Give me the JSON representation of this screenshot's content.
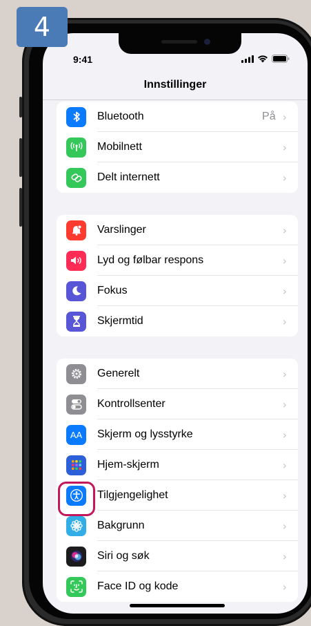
{
  "step": {
    "number": "4"
  },
  "status_bar": {
    "time": "9:41"
  },
  "nav": {
    "title": "Innstillinger"
  },
  "colors": {
    "highlight": "#c2185b",
    "step_badge": "#4a7bb7"
  },
  "groups": [
    {
      "items": [
        {
          "label": "Bluetooth",
          "value": "På",
          "icon": "bluetooth-icon",
          "color": "#0a7aff"
        },
        {
          "label": "Mobilnett",
          "value": "",
          "icon": "antenna-icon",
          "color": "#34c759"
        },
        {
          "label": "Delt internett",
          "value": "",
          "icon": "link-icon",
          "color": "#34c759"
        }
      ]
    },
    {
      "items": [
        {
          "label": "Varslinger",
          "value": "",
          "icon": "bell-icon",
          "color": "#ff3b30"
        },
        {
          "label": "Lyd og følbar respons",
          "value": "",
          "icon": "speaker-icon",
          "color": "#ff2d55"
        },
        {
          "label": "Fokus",
          "value": "",
          "icon": "moon-icon",
          "color": "#5856d6"
        },
        {
          "label": "Skjermtid",
          "value": "",
          "icon": "hourglass-icon",
          "color": "#5856d6"
        }
      ]
    },
    {
      "items": [
        {
          "label": "Generelt",
          "value": "",
          "icon": "gear-icon",
          "color": "#8e8e93"
        },
        {
          "label": "Kontrollsenter",
          "value": "",
          "icon": "toggles-icon",
          "color": "#8e8e93"
        },
        {
          "label": "Skjerm og lysstyrke",
          "value": "",
          "icon": "text-size-icon",
          "color": "#0a7aff",
          "glyph": "AA"
        },
        {
          "label": "Hjem-skjerm",
          "value": "",
          "icon": "app-grid-icon",
          "color": "#2c5fd8"
        },
        {
          "label": "Tilgjengelighet",
          "value": "",
          "icon": "accessibility-icon",
          "color": "#0a7aff"
        },
        {
          "label": "Bakgrunn",
          "value": "",
          "icon": "flower-icon",
          "color": "#32ade6"
        },
        {
          "label": "Siri og søk",
          "value": "",
          "icon": "siri-icon",
          "color": "#1c1c1e"
        },
        {
          "label": "Face ID og kode",
          "value": "",
          "icon": "face-id-icon",
          "color": "#34c759"
        }
      ]
    }
  ]
}
